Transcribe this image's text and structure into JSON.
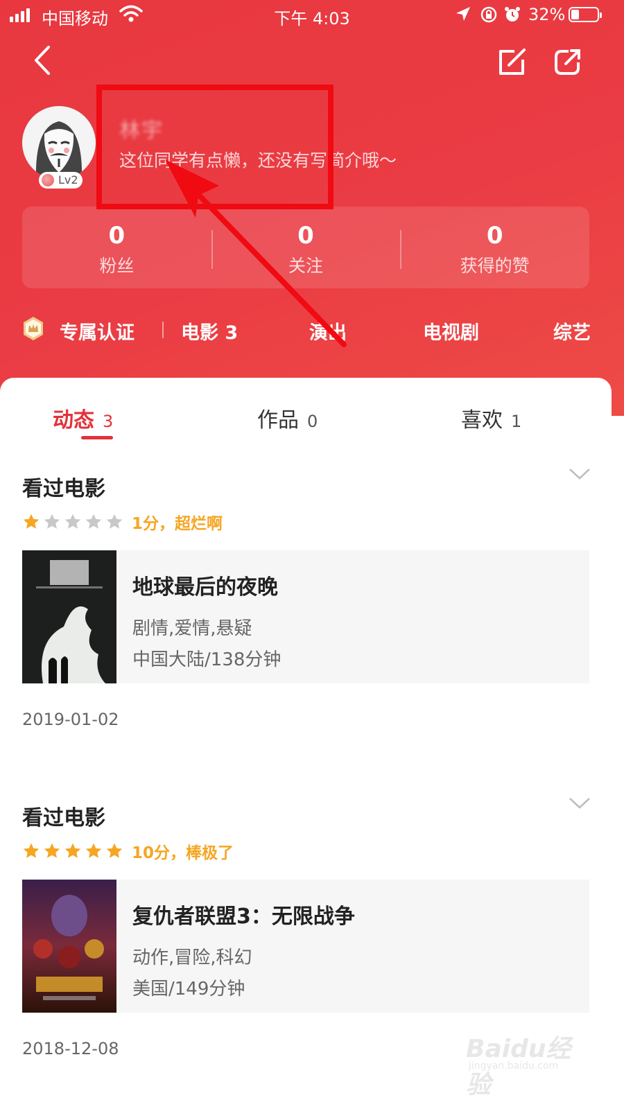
{
  "status_bar": {
    "carrier": "中国移动",
    "time": "下午 4:03",
    "battery": "32%"
  },
  "profile": {
    "name": "林宇",
    "bio": "这位同学有点懒，还没有写简介哦～",
    "level": "Lv2"
  },
  "stats": [
    {
      "value": "0",
      "label": "粉丝"
    },
    {
      "value": "0",
      "label": "关注"
    },
    {
      "value": "0",
      "label": "获得的赞"
    }
  ],
  "categories": {
    "certification": "专属认证",
    "items": [
      "电影 3",
      "演出",
      "电视剧",
      "综艺"
    ]
  },
  "tabs": [
    {
      "label": "动态",
      "count": "3",
      "active": true
    },
    {
      "label": "作品",
      "count": "0",
      "active": false
    },
    {
      "label": "喜欢",
      "count": "1",
      "active": false
    }
  ],
  "feed": [
    {
      "title": "看过电影",
      "rating_stars": 1,
      "rating_max": 5,
      "rating_text": "1分，超烂啊",
      "movie": {
        "name": "地球最后的夜晚",
        "genre": "剧情,爱情,悬疑",
        "info": "中国大陆/138分钟"
      },
      "date": "2019-01-02"
    },
    {
      "title": "看过电影",
      "rating_stars": 5,
      "rating_max": 5,
      "rating_text": "10分，棒极了",
      "movie": {
        "name": "复仇者联盟3：无限战争",
        "genre": "动作,冒险,科幻",
        "info": "美国/149分钟"
      },
      "date": "2018-12-08"
    }
  ],
  "watermark": {
    "main": "Baidu经验",
    "sub": "jingyan.baidu.com"
  },
  "colors": {
    "header": "#e8373f",
    "accent": "#e3323a",
    "star_on": "#f5a623",
    "star_off": "#c8c8c8",
    "annotation": "#f00a12"
  },
  "icons": [
    "back-icon",
    "edit-icon",
    "share-icon",
    "crown-icon",
    "chevron-down-icon",
    "star-icon"
  ]
}
